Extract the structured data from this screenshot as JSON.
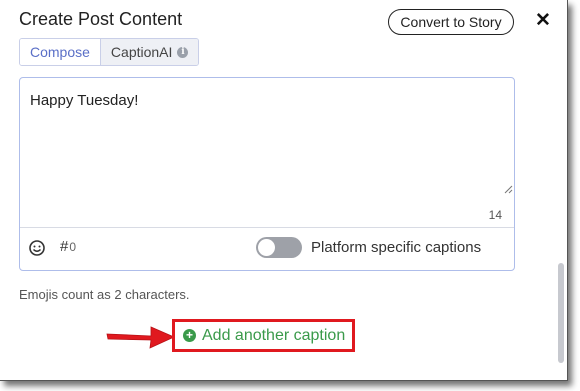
{
  "dialog": {
    "title": "Create Post Content",
    "convert_button": "Convert to Story",
    "close_label": "✕"
  },
  "tabs": [
    {
      "label": "Compose",
      "active": true
    },
    {
      "label": "CaptionAI",
      "active": false
    }
  ],
  "editor": {
    "value": "Happy Tuesday!",
    "char_count": "14",
    "hashtag_symbol": "#",
    "hashtag_count": "0",
    "platform_toggle_label": "Platform specific captions",
    "platform_toggle_on": false
  },
  "note": "Emojis count as 2 characters.",
  "add_caption": {
    "label": "Add another caption",
    "icon": "plus-circle-icon",
    "color": "#3a9a4a"
  },
  "annotation": {
    "highlight_color": "#e0191f",
    "arrow_icon": "arrow-right-icon"
  }
}
